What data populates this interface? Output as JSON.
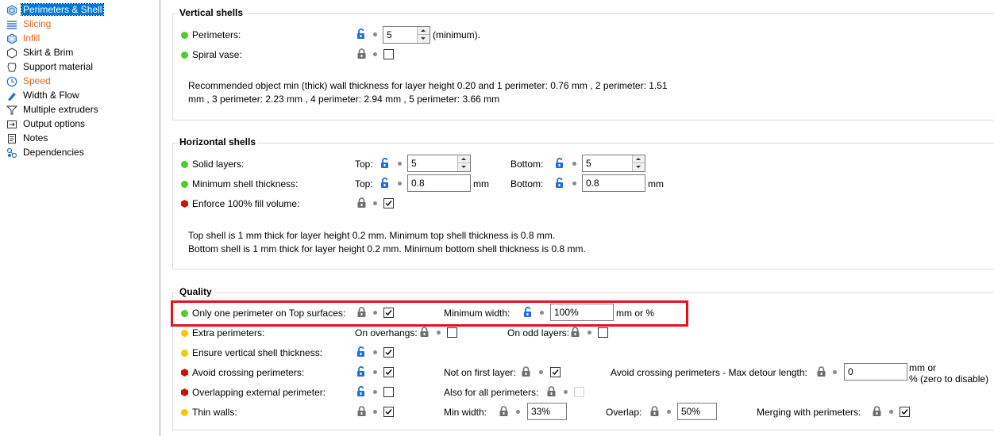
{
  "sidebar": {
    "items": [
      {
        "label": "Perimeters & Shell",
        "icon": "perimeters-shell-icon",
        "selected": true,
        "orange": false
      },
      {
        "label": "Slicing",
        "icon": "slicing-icon",
        "selected": false,
        "orange": true
      },
      {
        "label": "Infill",
        "icon": "infill-icon",
        "selected": false,
        "orange": true
      },
      {
        "label": "Skirt & Brim",
        "icon": "skirt-brim-icon",
        "selected": false,
        "orange": false
      },
      {
        "label": "Support material",
        "icon": "support-material-icon",
        "selected": false,
        "orange": false
      },
      {
        "label": "Speed",
        "icon": "speed-icon",
        "selected": false,
        "orange": true
      },
      {
        "label": "Width & Flow",
        "icon": "width-flow-icon",
        "selected": false,
        "orange": false
      },
      {
        "label": "Multiple extruders",
        "icon": "multiple-extruders-icon",
        "selected": false,
        "orange": false
      },
      {
        "label": "Output options",
        "icon": "output-options-icon",
        "selected": false,
        "orange": false
      },
      {
        "label": "Notes",
        "icon": "notes-icon",
        "selected": false,
        "orange": false
      },
      {
        "label": "Dependencies",
        "icon": "dependencies-icon",
        "selected": false,
        "orange": false
      }
    ]
  },
  "colors": {
    "green": "#4dcc2c",
    "red": "#d20f0f",
    "yellow": "#f5c900",
    "lock_blue": "#1f6fd6",
    "lock_gray": "#6e6e6e",
    "highlight": "#e6101d"
  },
  "vertical_shells": {
    "title": "Vertical shells",
    "perimeters": {
      "label": "Perimeters:",
      "value": "5",
      "suffix": "(minimum)."
    },
    "spiral_vase": {
      "label": "Spiral vase:"
    },
    "info": "Recommended object min (thick) wall thickness for layer height 0.20 and 1 perimeter: 0.76 mm , 2 perimeter: 1.51\nmm , 3 perimeter: 2.23 mm , 4 perimeter: 2.94 mm , 5 perimeter: 3.66 mm"
  },
  "horizontal_shells": {
    "title": "Horizontal shells",
    "solid_layers": {
      "label": "Solid layers:",
      "top_label": "Top:",
      "top_value": "5",
      "bottom_label": "Bottom:",
      "bottom_value": "5"
    },
    "min_shell": {
      "label": "Minimum shell thickness:",
      "top_label": "Top:",
      "top_value": "0.8",
      "top_unit": "mm",
      "bottom_label": "Bottom:",
      "bottom_value": "0.8",
      "bottom_unit": "mm"
    },
    "enforce_fill": {
      "label": "Enforce 100% fill volume:"
    },
    "info": "Top shell is 1 mm thick for layer height 0.2 mm. Minimum top shell thickness is 0.8 mm.\nBottom shell is 1 mm thick for layer height 0.2 mm. Minimum bottom shell thickness is 0.8 mm."
  },
  "quality": {
    "title": "Quality",
    "one_perimeter": {
      "label": "Only one perimeter on Top surfaces:",
      "min_width_label": "Minimum width:",
      "min_width_value": "100%",
      "unit": "mm or %"
    },
    "extra_perimeters": {
      "label": "Extra perimeters:",
      "overhangs_label": "On overhangs:",
      "odd_label": "On odd layers:"
    },
    "ensure_vertical": {
      "label": "Ensure vertical shell thickness:"
    },
    "avoid_crossing": {
      "label": "Avoid crossing perimeters:",
      "not_first_label": "Not on first layer:",
      "max_detour_label": "Avoid crossing perimeters - Max detour length:",
      "max_detour_value": "0",
      "unit_line1": "mm or",
      "unit_line2": "% (zero to disable)"
    },
    "overlapping": {
      "label": "Overlapping external perimeter:",
      "also_all_label": "Also for all perimeters:"
    },
    "thin_walls": {
      "label": "Thin walls:",
      "min_width_label": "Min width:",
      "min_width_value": "33%",
      "overlap_label": "Overlap:",
      "overlap_value": "50%",
      "merging_label": "Merging with perimeters:"
    }
  }
}
